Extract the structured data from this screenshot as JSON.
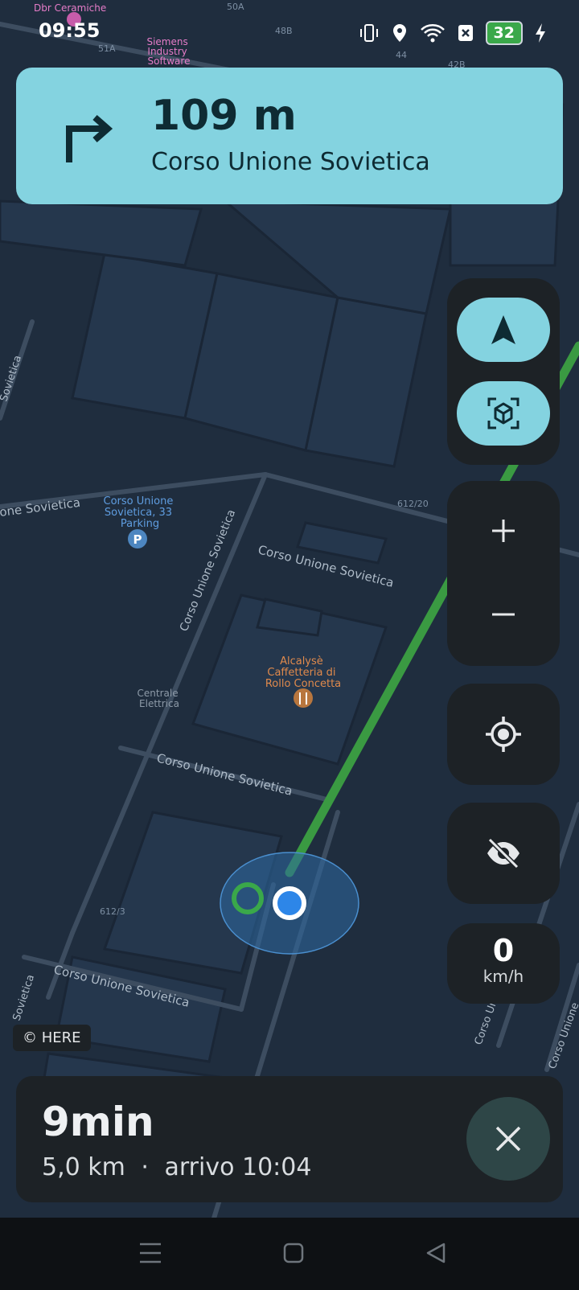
{
  "status_bar": {
    "time": "09:55",
    "battery": "32"
  },
  "map": {
    "labels": {
      "poi_top": "Dbr Ceramiche",
      "siemens": [
        "Siemens",
        "Industry",
        "Software"
      ],
      "road_50a": "50A",
      "road_51a": "51A",
      "road_48b": "48B",
      "road_44": "44",
      "road_42b": "42B",
      "parking": [
        "Corso Unione",
        "Sovietica, 33",
        "Parking"
      ],
      "street_left": "one Sovietica",
      "street_mid": "Corso Unione Sovietica",
      "street_vertical": "Corso Unione Sovietica",
      "street_lower": "Corso Unione Sovietica",
      "street_bottom": "Corso Unione Sovietica",
      "street_far_left": "Sovietica",
      "street_edge_left": "Sovietica",
      "street_right1": "Corso Uni",
      "street_right2": "Corso Unione",
      "addr_612_20": "612/20",
      "addr_612_3": "612/3",
      "cafe": [
        "Alcalysè",
        "Caffetteria di",
        "Rollo Concetta"
      ],
      "centrale": [
        "Centrale",
        "Elettrica"
      ]
    }
  },
  "maneuver": {
    "distance": "109 m",
    "street": "Corso Unione Sovietica"
  },
  "controls": {
    "speed_value": "0",
    "speed_unit": "km/h",
    "icons": [
      "navigation-arrow-icon",
      "3d-view-icon",
      "zoom-in-icon",
      "zoom-out-icon",
      "locate-icon",
      "hide-icon"
    ]
  },
  "attribution": "© HERE",
  "trip": {
    "eta_duration": "9min",
    "distance": "5,0 km",
    "separator": "·",
    "arrival": "arrivo 10:04"
  },
  "colors": {
    "accent": "#84d3e0",
    "route": "#3a9a42",
    "panel": "#1d2226",
    "map_bg": "#1f2d3e"
  }
}
